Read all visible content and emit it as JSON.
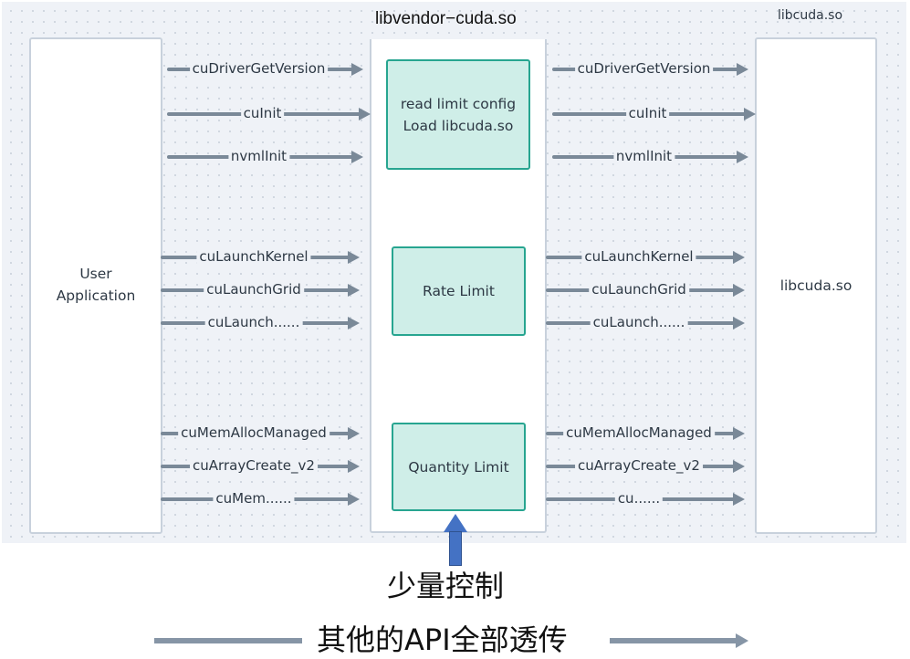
{
  "diagram": {
    "nodes": {
      "user_app": {
        "label_line1": "User",
        "label_line2": "Application"
      },
      "vendor": {
        "title": "libvendor−cuda.so",
        "blocks": [
          {
            "line1": "read limit config",
            "line2": "Load libcuda.so"
          },
          {
            "line1": "Rate Limit"
          },
          {
            "line1": "Quantity Limit"
          }
        ]
      },
      "libcuda": {
        "title": "libcuda.so",
        "label": "libcuda.so"
      }
    },
    "left_edges": [
      "cuDriverGetVersion",
      "cuInit",
      "nvmlInit",
      "cuLaunchKernel",
      "cuLaunchGrid",
      "cuLaunch......",
      "cuMemAllocManaged",
      "cuArrayCreate_v2",
      "cuMem......"
    ],
    "right_edges": [
      "cuDriverGetVersion",
      "cuInit",
      "nvmlInit",
      "cuLaunchKernel",
      "cuLaunchGrid",
      "cuLaunch......",
      "cuMemAllocManaged",
      "cuArrayCreate_v2",
      "cu......"
    ],
    "annotations": {
      "small_control": "少量控制",
      "passthrough": "其他的API全部透传"
    },
    "colors": {
      "canvas_bg": "#eff2f7",
      "edge": "#7a8998",
      "block_fill": "#cfeee8",
      "block_border": "#27a590",
      "highlight_arrow": "#4472c4"
    }
  }
}
